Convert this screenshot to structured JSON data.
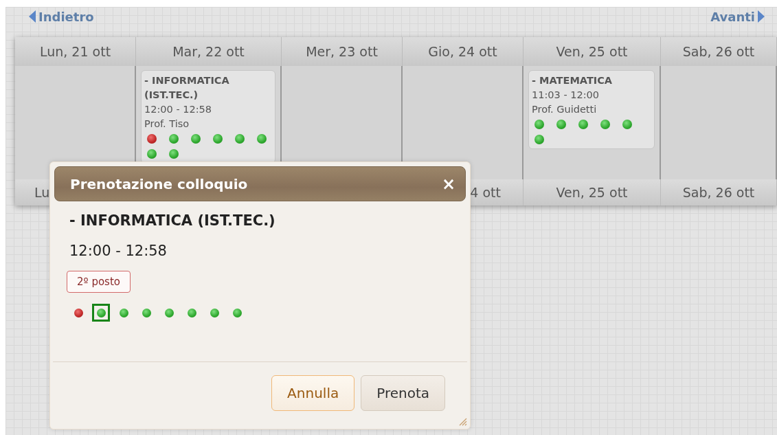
{
  "nav": {
    "back": "Indietro",
    "forward": "Avanti"
  },
  "days": [
    {
      "label": "Lun, 21 ott",
      "footer": "Lu"
    },
    {
      "label": "Mar, 22 ott",
      "events": [
        {
          "subject": "- INFORMATICA (IST.TEC.)",
          "time": "12:00 - 12:58",
          "teacher": "Prof. Tiso",
          "slots": [
            {
              "available": false
            },
            {
              "available": true
            },
            {
              "available": true
            },
            {
              "available": true
            },
            {
              "available": true
            },
            {
              "available": true
            },
            {
              "available": true
            },
            {
              "available": true
            }
          ]
        }
      ]
    },
    {
      "label": "Mer, 23 ott"
    },
    {
      "label": "Gio, 24 ott",
      "footer": "4 ott"
    },
    {
      "label": "Ven, 25 ott",
      "footer": "Ven, 25 ott",
      "events": [
        {
          "subject": "- MATEMATICA",
          "time": "11:03 - 12:00",
          "teacher": "Prof. Guidetti",
          "slots": [
            {
              "available": true
            },
            {
              "available": true
            },
            {
              "available": true
            },
            {
              "available": true
            },
            {
              "available": true
            },
            {
              "available": true
            }
          ]
        }
      ]
    },
    {
      "label": "Sab, 26 ott",
      "footer": "Sab, 26 ott"
    }
  ],
  "dialog": {
    "title": "Prenotazione colloquio",
    "close": "×",
    "subject": "- INFORMATICA (IST.TEC.)",
    "time": "12:00 - 12:58",
    "tooltip": "2º posto",
    "slots": [
      {
        "available": false,
        "selected": false
      },
      {
        "available": true,
        "selected": true
      },
      {
        "available": true,
        "selected": false
      },
      {
        "available": true,
        "selected": false
      },
      {
        "available": true,
        "selected": false
      },
      {
        "available": true,
        "selected": false
      },
      {
        "available": true,
        "selected": false
      },
      {
        "available": true,
        "selected": false
      }
    ],
    "buttons": [
      {
        "label": "Annulla",
        "kind": "cancel"
      },
      {
        "label": "Prenota",
        "kind": "confirm"
      }
    ]
  }
}
